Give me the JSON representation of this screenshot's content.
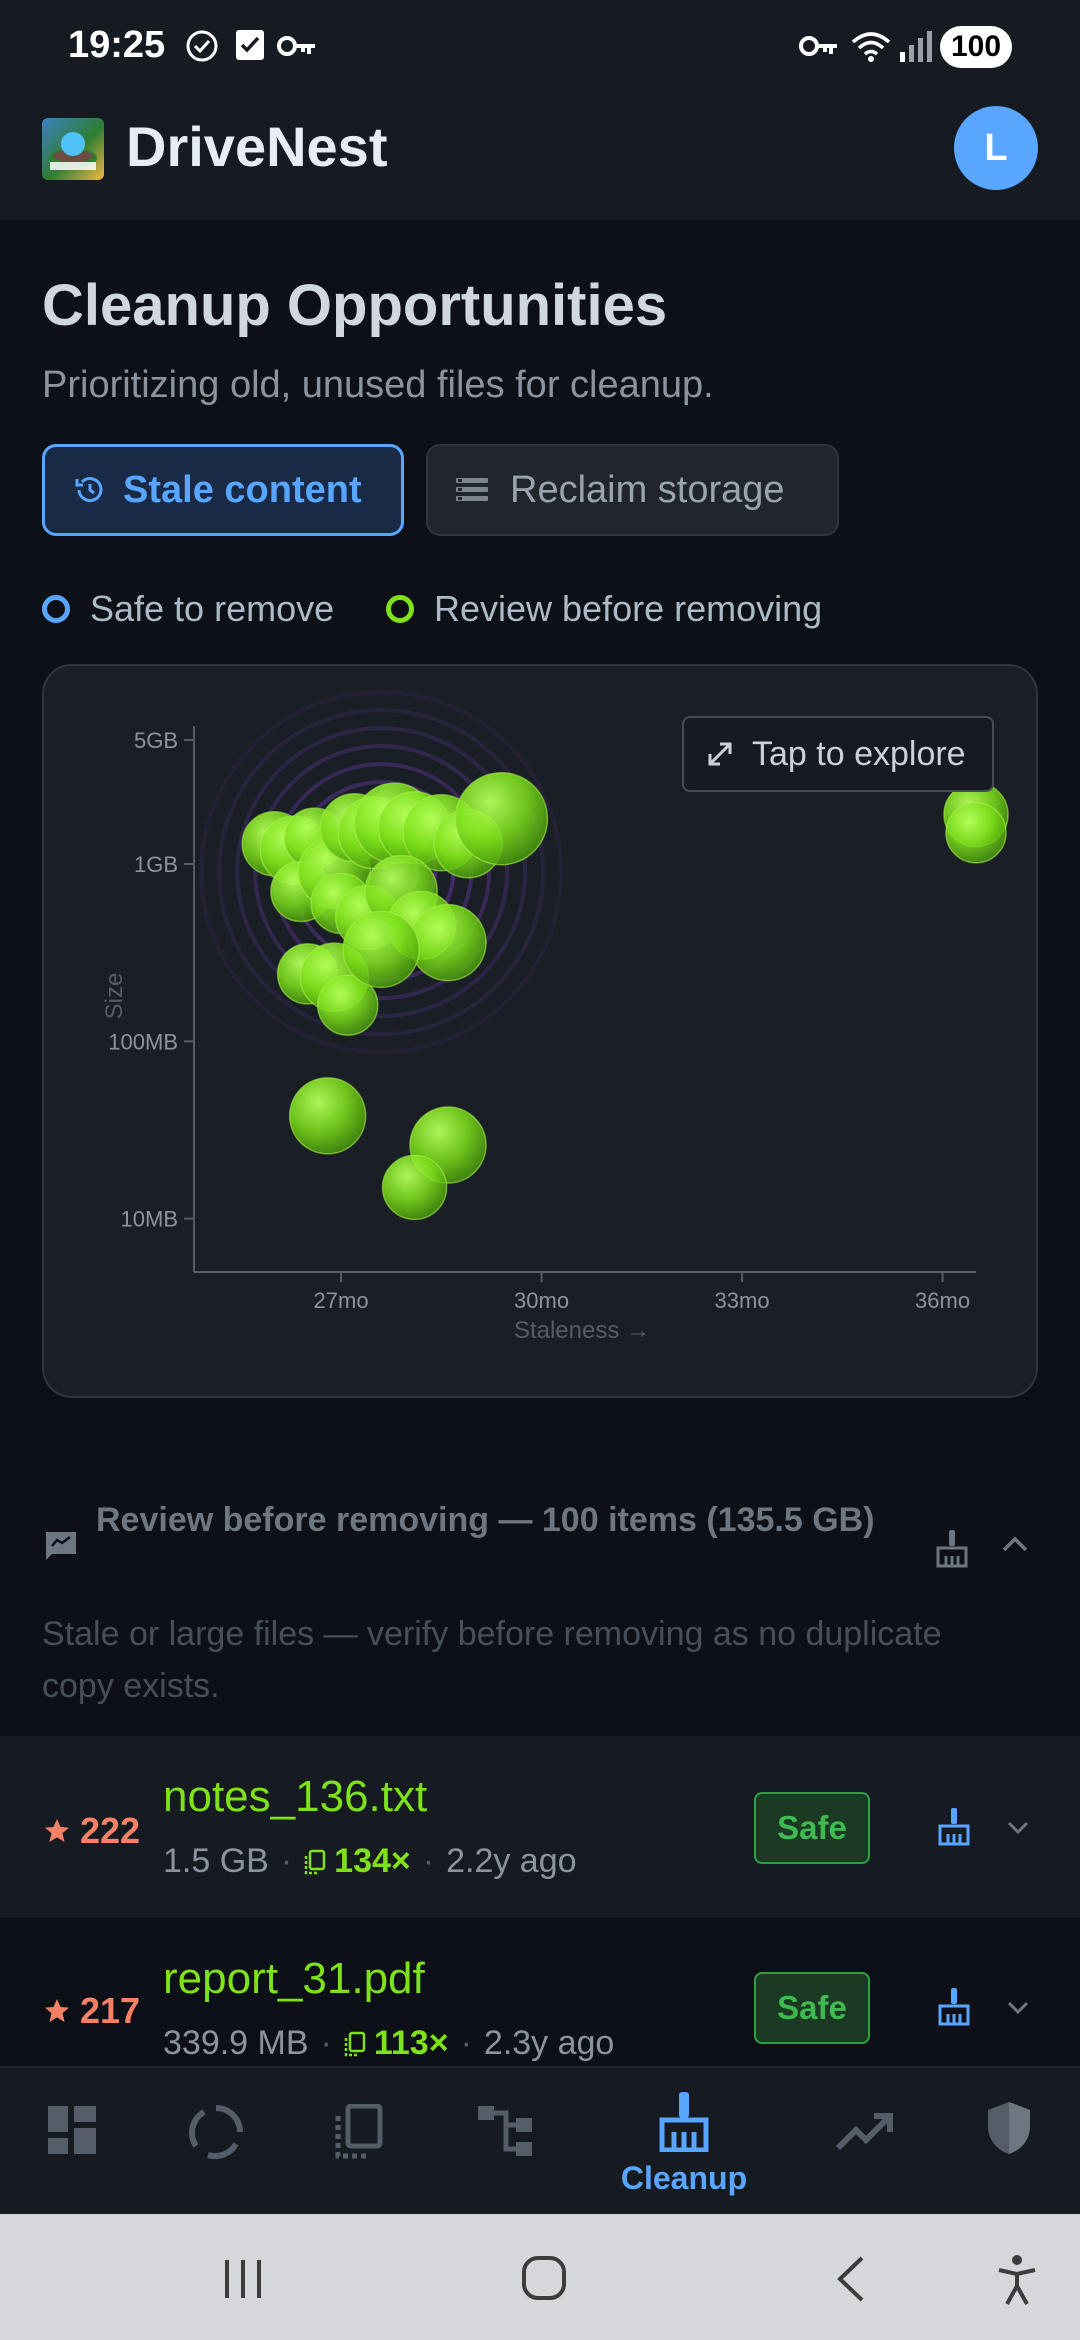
{
  "status_bar": {
    "time": "19:25",
    "battery": "100"
  },
  "app_bar": {
    "title": "DriveNest",
    "avatar_initial": "L"
  },
  "page": {
    "title": "Cleanup Opportunities",
    "subtitle": "Prioritizing old, unused files for cleanup."
  },
  "tabs": [
    {
      "label": "Stale content",
      "icon": "history-icon",
      "active": true
    },
    {
      "label": "Reclaim storage",
      "icon": "list-icon",
      "active": false
    }
  ],
  "legend": [
    {
      "label": "Safe to remove",
      "color": "#58a6ff"
    },
    {
      "label": "Review before removing",
      "color": "#7ee11a"
    }
  ],
  "chart": {
    "explore_label": "Tap to explore"
  },
  "chart_data": {
    "type": "scatter",
    "xlabel": "Staleness →",
    "ylabel": "Size",
    "x_ticks": [
      "27mo",
      "30mo",
      "33mo",
      "36mo"
    ],
    "y_ticks": [
      "5GB",
      "1GB",
      "100MB",
      "10MB"
    ],
    "x_range_months": [
      24.8,
      36.5
    ],
    "y_scale": "log",
    "y_range_mb": [
      5,
      6000
    ],
    "grid": false,
    "series": [
      {
        "name": "Review before removing",
        "color": "#7ee11a",
        "points": [
          {
            "x": 26.0,
            "y_mb": 1300
          },
          {
            "x": 26.3,
            "y_mb": 1200
          },
          {
            "x": 26.6,
            "y_mb": 1400
          },
          {
            "x": 26.4,
            "y_mb": 700
          },
          {
            "x": 26.9,
            "y_mb": 900
          },
          {
            "x": 27.2,
            "y_mb": 1600
          },
          {
            "x": 27.5,
            "y_mb": 1500
          },
          {
            "x": 27.8,
            "y_mb": 1700
          },
          {
            "x": 28.1,
            "y_mb": 1600
          },
          {
            "x": 28.5,
            "y_mb": 1500
          },
          {
            "x": 28.9,
            "y_mb": 1300
          },
          {
            "x": 29.4,
            "y_mb": 1800
          },
          {
            "x": 27.0,
            "y_mb": 600
          },
          {
            "x": 27.4,
            "y_mb": 500
          },
          {
            "x": 27.9,
            "y_mb": 700
          },
          {
            "x": 28.2,
            "y_mb": 450
          },
          {
            "x": 28.6,
            "y_mb": 360
          },
          {
            "x": 26.5,
            "y_mb": 240
          },
          {
            "x": 26.9,
            "y_mb": 230
          },
          {
            "x": 27.1,
            "y_mb": 160
          },
          {
            "x": 27.6,
            "y_mb": 330
          },
          {
            "x": 26.8,
            "y_mb": 38
          },
          {
            "x": 28.6,
            "y_mb": 26
          },
          {
            "x": 28.1,
            "y_mb": 15
          },
          {
            "x": 36.5,
            "y_mb": 1900
          },
          {
            "x": 36.5,
            "y_mb": 1500
          }
        ]
      }
    ]
  },
  "review_section": {
    "title": "Review before removing — 100 items (135.5 GB)",
    "description": "Stale or large files — verify before removing as no duplicate copy exists."
  },
  "files": [
    {
      "score": "222",
      "name": "notes_136.txt",
      "size": "1.5 GB",
      "duplicates": "134×",
      "age": "2.2y ago",
      "badge": "Safe"
    },
    {
      "score": "217",
      "name": "report_31.pdf",
      "size": "339.9 MB",
      "duplicates": "113×",
      "age": "2.3y ago",
      "badge": "Safe"
    }
  ],
  "bottom_nav": {
    "items": [
      {
        "icon": "dashboard-icon",
        "label": ""
      },
      {
        "icon": "spinner-icon",
        "label": ""
      },
      {
        "icon": "copy-icon",
        "label": ""
      },
      {
        "icon": "tree-icon",
        "label": ""
      },
      {
        "icon": "broom-icon",
        "label": "Cleanup",
        "active": true
      },
      {
        "icon": "trending-icon",
        "label": ""
      },
      {
        "icon": "shield-icon",
        "label": ""
      }
    ]
  }
}
